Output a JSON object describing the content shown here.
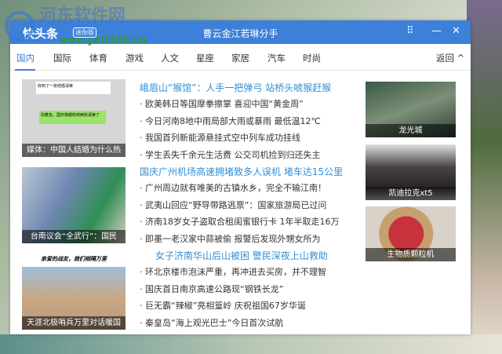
{
  "window": {
    "app_name": "快头条",
    "badge": "迷你版",
    "title": "曹云金江若琳分手"
  },
  "watermark": {
    "text": "河东软件网",
    "url": "www.pc0359.cn"
  },
  "nav": {
    "tabs": [
      "国内",
      "国际",
      "体育",
      "游戏",
      "人文",
      "星座",
      "家居",
      "汽车",
      "时尚"
    ],
    "back": "返回 ^"
  },
  "left_images": [
    {
      "caption": "媒体：中国人结婚为什么热",
      "chat": "收到了一张结婚请柬",
      "chat2": "别着急，国庆我都收到两张请柬了"
    },
    {
      "caption": "台南议会“全武行”：国民"
    },
    {
      "caption": "天涯北极哨兵万里对话暖国",
      "banner": "亲爱的战友，我们相隔万里"
    }
  ],
  "news": [
    {
      "text": "峨眉山“猴馆”：人手一把弹弓 站桥头唬猴赶猴",
      "headline": true
    },
    {
      "text": "· 欧美韩日等国摩拳擦掌 喜迎中国“黄金周”"
    },
    {
      "text": "· 今日河南8地中雨局部大雨或暴雨 最低温12℃"
    },
    {
      "text": "· 我国首列新能源悬挂式空中列车成功挂线"
    },
    {
      "text": "· 学生丢失千余元生活费 公交司机捡到归还失主"
    },
    {
      "text": "国庆广州机场高速拥堵致多人误机 堵车达15公里",
      "headline": true
    },
    {
      "text": "· 广州周边就有唯美的古镇水乡，完全不输江南！"
    },
    {
      "text": "· 武夷山回应“野导带路逃票”：国家旅游局已过问"
    },
    {
      "text": "· 济南18岁女子盗取合租闺蜜银行卡 1年半取走16万"
    },
    {
      "text": "· 即墨一老汉家中蒜被偷 报警后发现外甥女所为"
    },
    {
      "text": "女子济南华山后山被困 警民深夜上山救助",
      "headline": true
    },
    {
      "text": "· 环北京楼市泡沫严重，再冲进去买房，并不理智"
    },
    {
      "text": "· 国庆首日南京高速公路现“钢铁长龙”"
    },
    {
      "text": "· 巨无霸“辣椒”亮相篁岭 庆祝祖国67岁华诞"
    },
    {
      "text": "· 秦皇岛“海上观光巴士”今日首次试航"
    }
  ],
  "right_images": [
    {
      "caption": "龙光城"
    },
    {
      "caption": "凯迪拉克xt5"
    },
    {
      "caption": "生物质颗粒机"
    }
  ],
  "colors": {
    "accent": "#3d80d9",
    "headline": "#2f8fd8"
  }
}
